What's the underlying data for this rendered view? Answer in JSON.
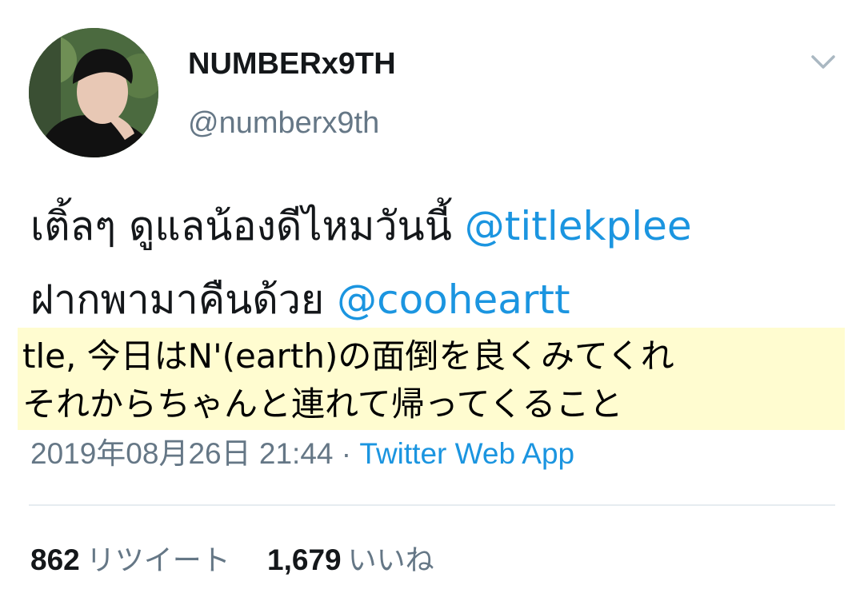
{
  "author": {
    "display_name": "NUMBERx9TH",
    "handle": "@numberx9th",
    "avatar_icon": "profile-photo"
  },
  "tweet": {
    "line1_text": "เติ้ลๆ ดูแลน้องดีไหมวันนี้ ",
    "line1_mention": "@titlekplee",
    "line2_text": "ฝากพามาคืนด้วย ",
    "line2_mention": "@cooheartt"
  },
  "translation": {
    "line1": "tle, 今日はN'(earth)の面倒を良くみてくれ",
    "line2": "それからちゃんと連れて帰ってくること",
    "highlight_color": "#fffcd0"
  },
  "meta": {
    "timestamp": "2019年08月26日 21:44",
    "separator": " · ",
    "source": "Twitter Web App"
  },
  "stats": {
    "retweets_count": "862",
    "retweets_label": "リツイート",
    "likes_count": "1,679",
    "likes_label": "いいね"
  },
  "colors": {
    "link": "#1b95e0",
    "secondary_text": "#657786",
    "primary_text": "#14171a"
  }
}
